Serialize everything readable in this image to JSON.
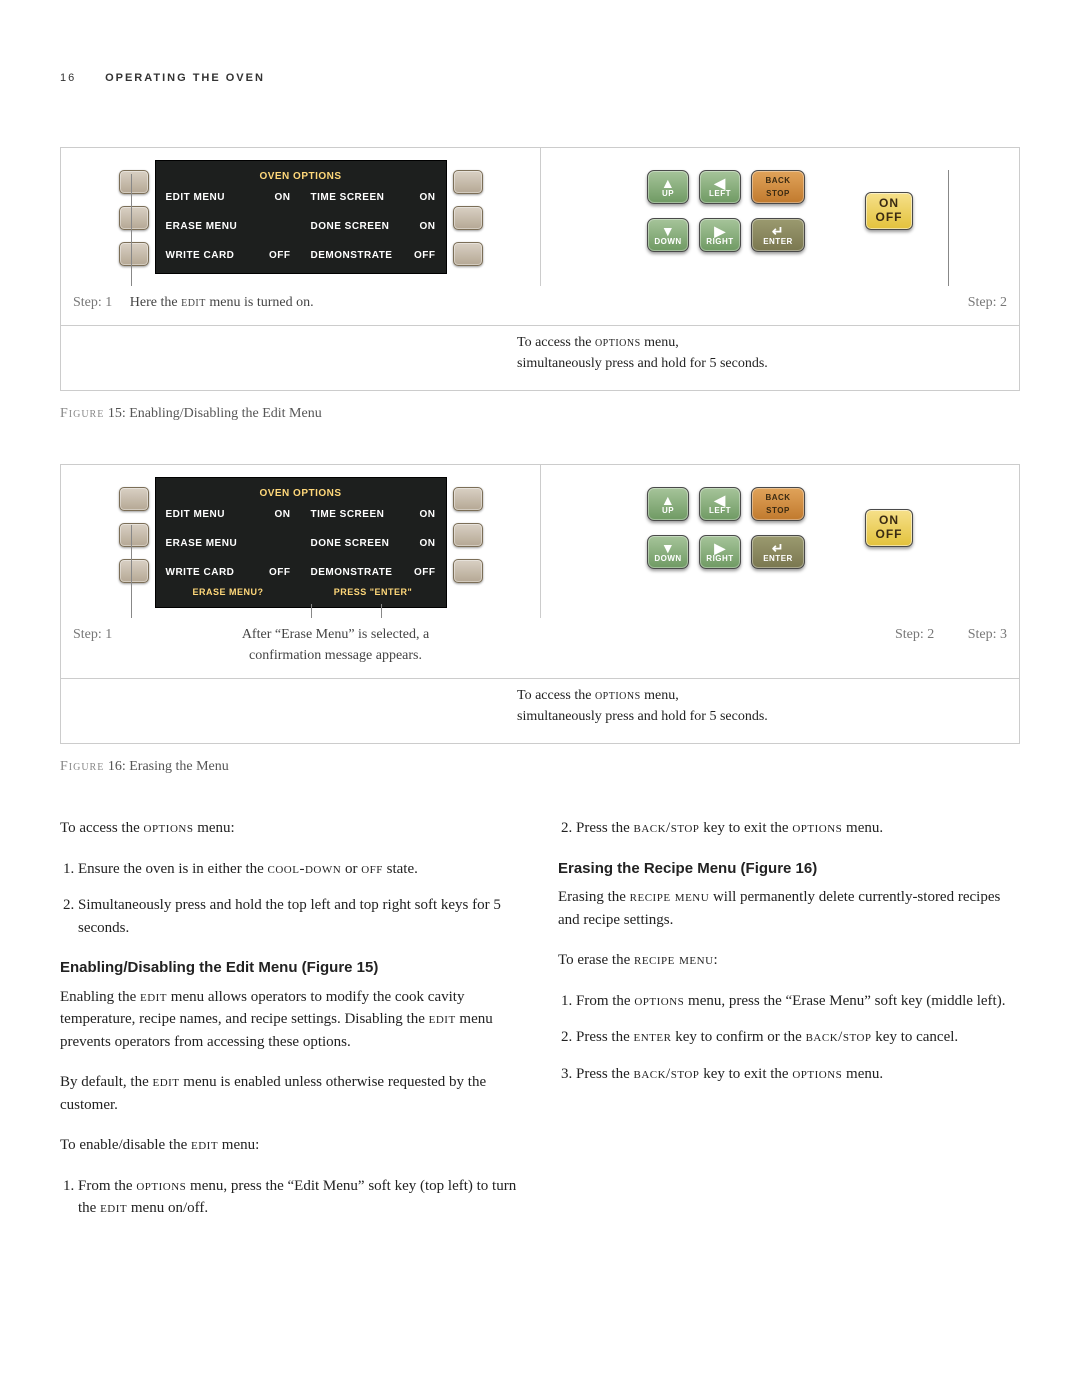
{
  "header": {
    "page": "16",
    "section": "OPERATING THE OVEN"
  },
  "fig15": {
    "screen": {
      "title": "OVEN OPTIONS",
      "rows": [
        {
          "l1": "EDIT MENU",
          "v1": "ON",
          "l2": "TIME SCREEN",
          "v2": "ON"
        },
        {
          "l1": "ERASE MENU",
          "v1": "",
          "l2": "DONE SCREEN",
          "v2": "ON"
        },
        {
          "l1": "WRITE CARD",
          "v1": "OFF",
          "l2": "DEMONSTRATE",
          "v2": "OFF"
        }
      ],
      "footer": ""
    },
    "caption_left_step": "Step: 1",
    "caption_left_text": "Here the EDIT menu is turned on.",
    "caption_right_step": "Step: 2",
    "footer_a": "To access the OPTIONS menu,",
    "footer_b": "simultaneously press and hold for 5 seconds.",
    "label": "FIGURE  15: Enabling/Disabling the Edit Menu"
  },
  "fig16": {
    "screen": {
      "title": "OVEN OPTIONS",
      "rows": [
        {
          "l1": "EDIT MENU",
          "v1": "ON",
          "l2": "TIME SCREEN",
          "v2": "ON"
        },
        {
          "l1": "ERASE MENU",
          "v1": "",
          "l2": "DONE SCREEN",
          "v2": "ON"
        },
        {
          "l1": "WRITE CARD",
          "v1": "OFF",
          "l2": "DEMONSTRATE",
          "v2": "OFF"
        }
      ],
      "footer_l": "ERASE MENU?",
      "footer_r": "PRESS \"ENTER\""
    },
    "caption_left_step": "Step: 1",
    "caption_left_text_a": "After “Erase Menu” is selected, a",
    "caption_left_text_b": "confirmation message appears.",
    "caption_right_step2": "Step: 2",
    "caption_right_step3": "Step: 3",
    "footer_a": "To access the OPTIONS menu,",
    "footer_b": "simultaneously press and hold for 5 seconds.",
    "label": "FIGURE  16: Erasing the Menu"
  },
  "keypad": {
    "up": "UP",
    "down": "DOWN",
    "left": "LEFT",
    "right": "RIGHT",
    "back": "BACK",
    "stop": "STOP",
    "enter": "ENTER",
    "on": "ON",
    "off": "OFF"
  },
  "text": {
    "left": {
      "intro": "To access the OPTIONS menu:",
      "l1": "Ensure the oven is in either the COOL-DOWN or OFF state.",
      "l2": "Simultaneously press and hold the top left and top right soft keys for 5 seconds.",
      "h": "Enabling/Disabling the Edit Menu (Figure 15)",
      "p1": "Enabling the EDIT menu allows operators to modify the cook cavity temperature, recipe names, and recipe settings. Disabling the EDIT menu prevents operators from accessing these options.",
      "p2": "By default, the EDIT menu is enabled unless otherwise requested by the customer.",
      "p3": "To enable/disable the EDIT menu:",
      "l3": "From the OPTIONS menu, press the “Edit Menu” soft key (top left) to turn the EDIT menu on/off."
    },
    "right": {
      "l1": "Press the BACK/STOP key to exit the OPTIONS menu.",
      "h": "Erasing the Recipe Menu (Figure 16)",
      "p1": "Erasing the RECIPE MENU will permanently delete currently-stored recipes and recipe settings.",
      "p2": "To erase the RECIPE MENU:",
      "r1": "From the OPTIONS menu, press the “Erase Menu” soft key (middle left).",
      "r2": "Press the ENTER key to confirm or the BACK/STOP key to cancel.",
      "r3": "Press the BACK/STOP key to exit the OPTIONS menu."
    }
  }
}
